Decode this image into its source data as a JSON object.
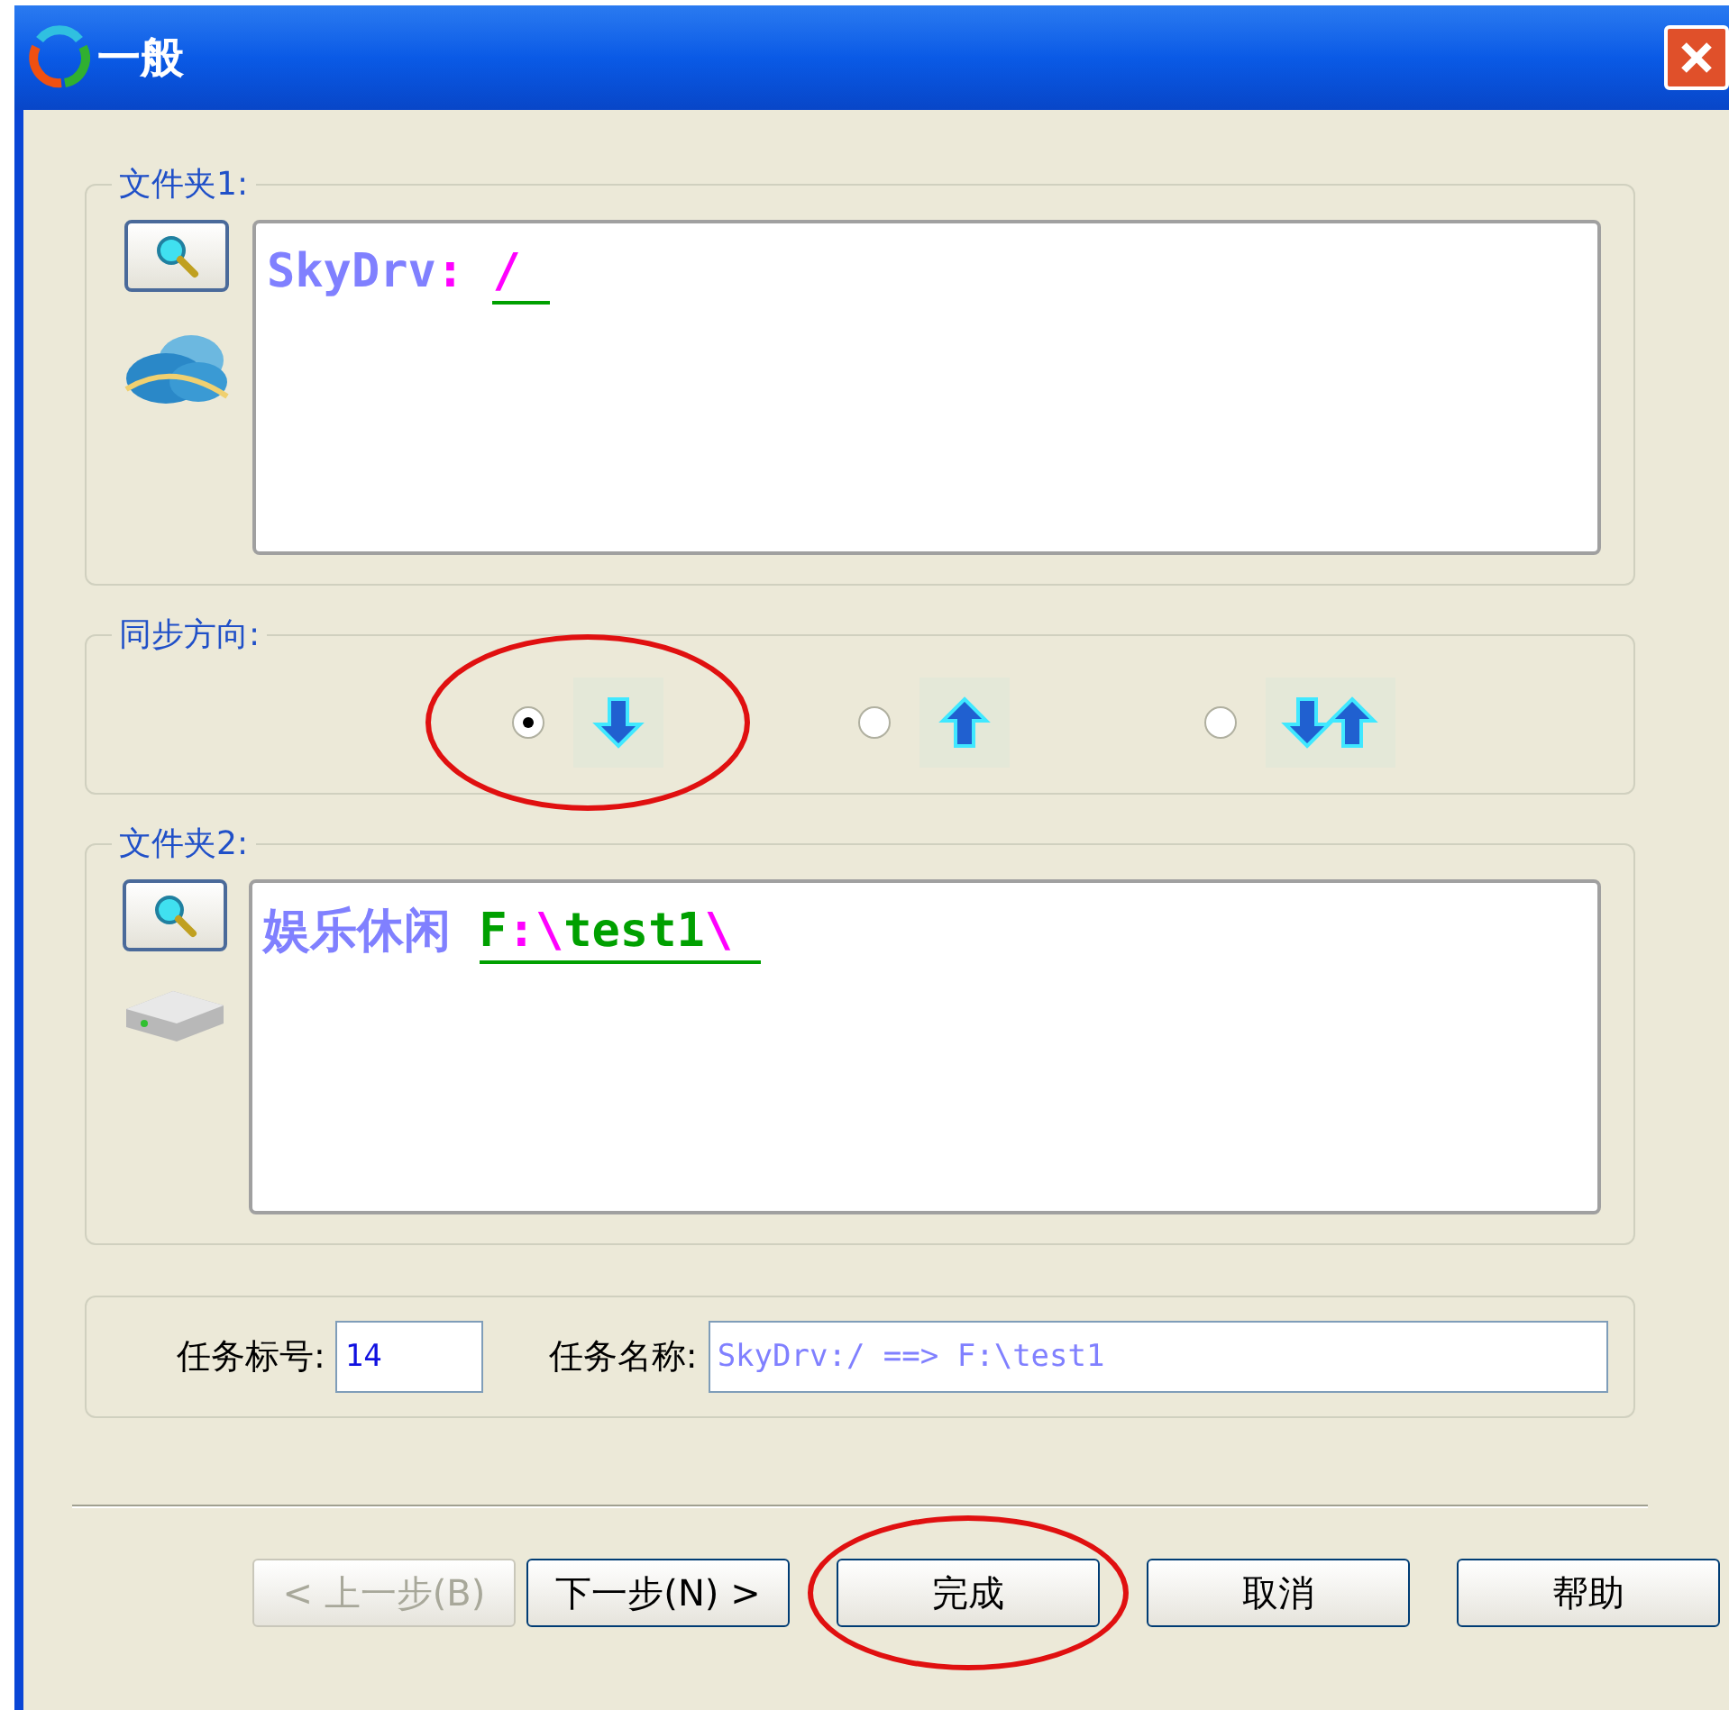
{
  "window": {
    "title": "一般"
  },
  "folder1": {
    "label": "文件夹1:",
    "path": [
      {
        "text": "SkyDrv",
        "color": "#8080ff",
        "underlined": false
      },
      {
        "text": ": ",
        "color": "#ff00ff",
        "underlined": false
      },
      {
        "text": "/ ",
        "color": "#ff00ff",
        "underlined": true
      }
    ]
  },
  "direction": {
    "label": "同步方向:",
    "options": [
      {
        "selected": true,
        "circled": true
      },
      {
        "selected": false,
        "circled": false
      },
      {
        "selected": false,
        "circled": false
      }
    ]
  },
  "folder2": {
    "label": "文件夹2:",
    "path": [
      {
        "text": "娱乐休闲 ",
        "color": "#8080ff",
        "underlined": false
      },
      {
        "text": "F",
        "color": "#00a000",
        "underlined": true
      },
      {
        "text": ":",
        "color": "#ff00ff",
        "underlined": true
      },
      {
        "text": "\\",
        "color": "#ff00ff",
        "underlined": true
      },
      {
        "text": "test1",
        "color": "#00a000",
        "underlined": true
      },
      {
        "text": "\\ ",
        "color": "#ff00ff",
        "underlined": true
      }
    ]
  },
  "task": {
    "id_label": "任务标号:",
    "id_value": "14",
    "name_label": "任务名称:",
    "name_value": "SkyDrv:/ ==> F:\\test1"
  },
  "buttons": [
    {
      "label": "< 上一步(B)",
      "disabled": true,
      "circled": false
    },
    {
      "label": "下一步(N) >",
      "disabled": false,
      "circled": false
    },
    {
      "label": "完成",
      "disabled": false,
      "circled": true
    },
    {
      "label": "取消",
      "disabled": false,
      "circled": false
    },
    {
      "label": "帮助",
      "disabled": false,
      "circled": false
    }
  ]
}
